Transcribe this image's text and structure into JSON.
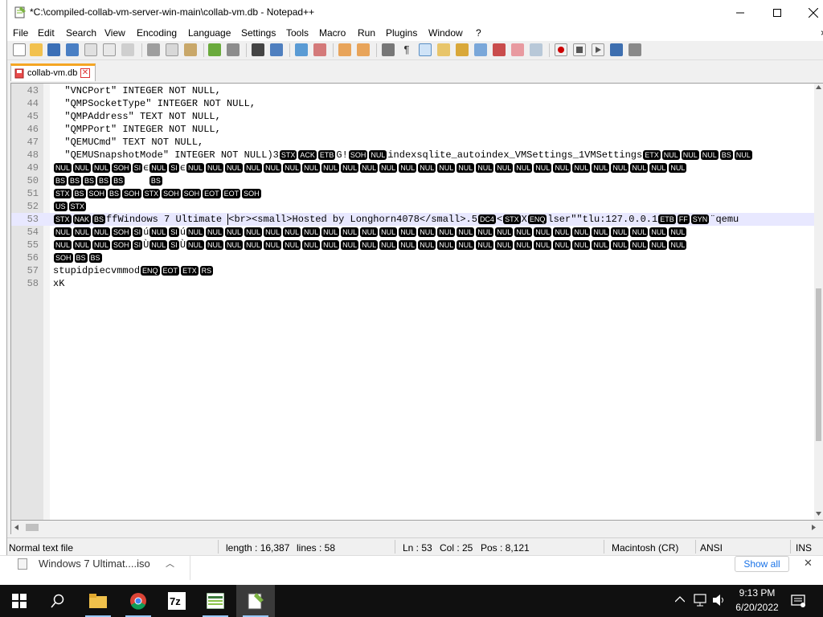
{
  "window": {
    "title": "*C:\\compiled-collab-vm-server-win-main\\collab-vm.db - Notepad++"
  },
  "menu": [
    "File",
    "Edit",
    "Search",
    "View",
    "Encoding",
    "Language",
    "Settings",
    "Tools",
    "Macro",
    "Run",
    "Plugins",
    "Window",
    "?"
  ],
  "tab": {
    "label": "collab-vm.db",
    "close": "✕"
  },
  "lines": [
    {
      "n": "43",
      "parts": [
        {
          "t": "  \"VNCPort\" INTEGER NOT NULL,"
        }
      ]
    },
    {
      "n": "44",
      "parts": [
        {
          "t": "  \"QMPSocketType\" INTEGER NOT NULL,"
        }
      ]
    },
    {
      "n": "45",
      "parts": [
        {
          "t": "  \"QMPAddress\" TEXT NOT NULL,"
        }
      ]
    },
    {
      "n": "46",
      "parts": [
        {
          "t": "  \"QMPPort\" INTEGER NOT NULL,"
        }
      ]
    },
    {
      "n": "47",
      "parts": [
        {
          "t": "  \"QEMUCmd\" TEXT NOT NULL,"
        }
      ]
    },
    {
      "n": "48",
      "parts": [
        {
          "t": "  \"QEMUSnapshotMode\" INTEGER NOT NULL)3"
        },
        {
          "c": "STX"
        },
        {
          "c": "ACK"
        },
        {
          "c": "ETB"
        },
        {
          "t": "G!"
        },
        {
          "c": "SOH"
        },
        {
          "c": "NUL"
        },
        {
          "t": "indexsqlite_autoindex_VMSettings_1VMSettings"
        },
        {
          "c": "ETX"
        },
        {
          "c": "NUL"
        },
        {
          "c": "NUL"
        },
        {
          "c": "NUL"
        },
        {
          "c": "BS"
        },
        {
          "c": "NUL"
        }
      ]
    },
    {
      "n": "49",
      "parts": [
        {
          "c": "NUL"
        },
        {
          "c": "NUL"
        },
        {
          "c": "NUL"
        },
        {
          "c": "SOH"
        },
        {
          "c": "SI"
        },
        {
          "t": "ϵ"
        },
        {
          "c": "NUL"
        },
        {
          "c": "SI"
        },
        {
          "t": "ϵ"
        },
        {
          "c": "NUL"
        },
        {
          "c": "NUL"
        },
        {
          "c": "NUL"
        },
        {
          "c": "NUL"
        },
        {
          "c": "NUL"
        },
        {
          "c": "NUL"
        },
        {
          "c": "NUL"
        },
        {
          "c": "NUL"
        },
        {
          "c": "NUL"
        },
        {
          "c": "NUL"
        },
        {
          "c": "NUL"
        },
        {
          "c": "NUL"
        },
        {
          "c": "NUL"
        },
        {
          "c": "NUL"
        },
        {
          "c": "NUL"
        },
        {
          "c": "NUL"
        },
        {
          "c": "NUL"
        },
        {
          "c": "NUL"
        },
        {
          "c": "NUL"
        },
        {
          "c": "NUL"
        },
        {
          "c": "NUL"
        },
        {
          "c": "NUL"
        },
        {
          "c": "NUL"
        },
        {
          "c": "NUL"
        },
        {
          "c": "NUL"
        },
        {
          "c": "NUL"
        }
      ]
    },
    {
      "n": "50",
      "parts": [
        {
          "c": "BS"
        },
        {
          "c": "BS"
        },
        {
          "c": "BS"
        },
        {
          "c": "BS"
        },
        {
          "c": "BS"
        },
        {
          "t": "    "
        },
        {
          "c": "BS"
        }
      ]
    },
    {
      "n": "51",
      "parts": [
        {
          "c": "STX"
        },
        {
          "c": "BS"
        },
        {
          "c": "SOH"
        },
        {
          "c": "BS"
        },
        {
          "c": "SOH"
        },
        {
          "c": "STX"
        },
        {
          "c": "SOH"
        },
        {
          "c": "SOH"
        },
        {
          "c": "EOT"
        },
        {
          "c": "EOT"
        },
        {
          "c": "SOH"
        }
      ]
    },
    {
      "n": "52",
      "parts": [
        {
          "c": "US"
        },
        {
          "c": "STX"
        }
      ]
    },
    {
      "n": "53",
      "current": true,
      "parts": [
        {
          "c": "STX"
        },
        {
          "c": "NAK"
        },
        {
          "c": "BS"
        },
        {
          "t": "ffWindows 7 Ultimate "
        },
        {
          "caret": true
        },
        {
          "t": "<br><small>Hosted by Longhorn4078</small>.5"
        },
        {
          "c": "DC4"
        },
        {
          "t": "<"
        },
        {
          "c": "STX"
        },
        {
          "t": "X"
        },
        {
          "c": "ENQ"
        },
        {
          "t": "lser\"\"tlu:127.0.0.1"
        },
        {
          "c": "ETB"
        },
        {
          "c": "FF"
        },
        {
          "c": "SYN"
        },
        {
          "t": "¨qemu"
        }
      ]
    },
    {
      "n": "54",
      "parts": [
        {
          "c": "NUL"
        },
        {
          "c": "NUL"
        },
        {
          "c": "NUL"
        },
        {
          "c": "SOH"
        },
        {
          "c": "SI"
        },
        {
          "t": "ú"
        },
        {
          "c": "NUL"
        },
        {
          "c": "SI"
        },
        {
          "t": "ú"
        },
        {
          "c": "NUL"
        },
        {
          "c": "NUL"
        },
        {
          "c": "NUL"
        },
        {
          "c": "NUL"
        },
        {
          "c": "NUL"
        },
        {
          "c": "NUL"
        },
        {
          "c": "NUL"
        },
        {
          "c": "NUL"
        },
        {
          "c": "NUL"
        },
        {
          "c": "NUL"
        },
        {
          "c": "NUL"
        },
        {
          "c": "NUL"
        },
        {
          "c": "NUL"
        },
        {
          "c": "NUL"
        },
        {
          "c": "NUL"
        },
        {
          "c": "NUL"
        },
        {
          "c": "NUL"
        },
        {
          "c": "NUL"
        },
        {
          "c": "NUL"
        },
        {
          "c": "NUL"
        },
        {
          "c": "NUL"
        },
        {
          "c": "NUL"
        },
        {
          "c": "NUL"
        },
        {
          "c": "NUL"
        },
        {
          "c": "NUL"
        },
        {
          "c": "NUL"
        }
      ]
    },
    {
      "n": "55",
      "parts": [
        {
          "c": "NUL"
        },
        {
          "c": "NUL"
        },
        {
          "c": "NUL"
        },
        {
          "c": "SOH"
        },
        {
          "c": "SI"
        },
        {
          "t": "Ù"
        },
        {
          "c": "NUL"
        },
        {
          "c": "SI"
        },
        {
          "t": "Ù"
        },
        {
          "c": "NUL"
        },
        {
          "c": "NUL"
        },
        {
          "c": "NUL"
        },
        {
          "c": "NUL"
        },
        {
          "c": "NUL"
        },
        {
          "c": "NUL"
        },
        {
          "c": "NUL"
        },
        {
          "c": "NUL"
        },
        {
          "c": "NUL"
        },
        {
          "c": "NUL"
        },
        {
          "c": "NUL"
        },
        {
          "c": "NUL"
        },
        {
          "c": "NUL"
        },
        {
          "c": "NUL"
        },
        {
          "c": "NUL"
        },
        {
          "c": "NUL"
        },
        {
          "c": "NUL"
        },
        {
          "c": "NUL"
        },
        {
          "c": "NUL"
        },
        {
          "c": "NUL"
        },
        {
          "c": "NUL"
        },
        {
          "c": "NUL"
        },
        {
          "c": "NUL"
        },
        {
          "c": "NUL"
        },
        {
          "c": "NUL"
        },
        {
          "c": "NUL"
        }
      ]
    },
    {
      "n": "56",
      "parts": [
        {
          "c": "SOH"
        },
        {
          "c": "BS"
        },
        {
          "c": "BS"
        }
      ]
    },
    {
      "n": "57",
      "parts": [
        {
          "t": "stupidpiecvmmod"
        },
        {
          "c": "ENQ"
        },
        {
          "c": "EOT"
        },
        {
          "c": "ETX"
        },
        {
          "c": "RS"
        }
      ]
    },
    {
      "n": "58",
      "parts": [
        {
          "t": "xK"
        }
      ]
    }
  ],
  "status": {
    "type": "Normal text file",
    "length": "length : 16,387",
    "lines": "lines : 58",
    "ln": "Ln : 53",
    "col": "Col : 25",
    "pos": "Pos : 8,121",
    "eol": "Macintosh (CR)",
    "encoding": "ANSI",
    "mode": "INS"
  },
  "download": {
    "filename": "Windows 7 Ultimat....iso",
    "show_all": "Show all"
  },
  "taskbar": {
    "time": "9:13 PM",
    "date": "6/20/2022"
  },
  "colors": {
    "accent": "#f5a623",
    "current_line": "#e8e8ff",
    "control_char_bg": "#000000",
    "taskbar_bg": "#101010"
  }
}
